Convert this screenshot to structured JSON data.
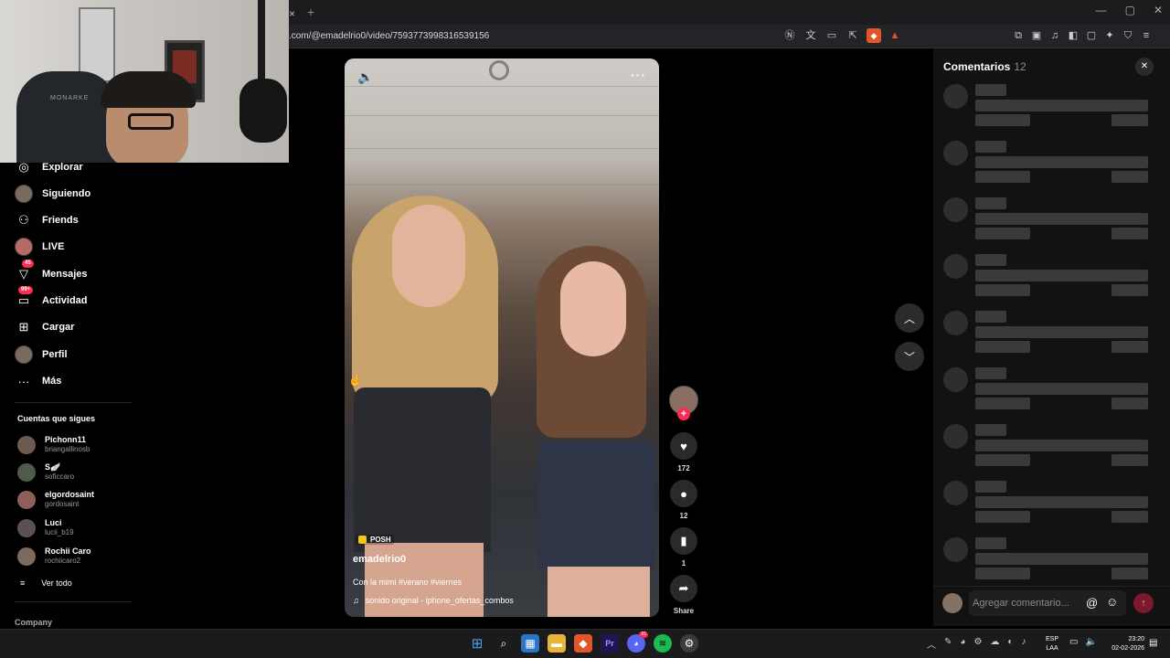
{
  "browser": {
    "url": ".com/@emadelrio0/video/7593773998316539156",
    "tab_close": "×",
    "tab_new": "+",
    "window_controls": [
      "—",
      "▢",
      "✕"
    ]
  },
  "webcam": {
    "chair_brand": "MONARKE"
  },
  "sidebar": {
    "nav": [
      {
        "label": "Explorar",
        "icon": "compass-icon",
        "glyph": "◉"
      },
      {
        "label": "Siguiendo",
        "icon": "following-avatar"
      },
      {
        "label": "Friends",
        "icon": "friends-icon",
        "glyph": "⚇"
      },
      {
        "label": "LIVE",
        "icon": "live-avatar"
      },
      {
        "label": "Mensajes",
        "icon": "messages-icon",
        "glyph": "▽",
        "badge": "45"
      },
      {
        "label": "Actividad",
        "icon": "activity-icon",
        "glyph": "▭",
        "badge": "99+"
      },
      {
        "label": "Cargar",
        "icon": "upload-icon",
        "glyph": "⊞"
      },
      {
        "label": "Perfil",
        "icon": "profile-avatar"
      },
      {
        "label": "Más",
        "icon": "more-icon",
        "glyph": "···"
      }
    ],
    "following_title": "Cuentas que sigues",
    "following": [
      {
        "name": "Pichonn11",
        "user": "briangallinosb"
      },
      {
        "name": "S🪽",
        "user": "soficcaro"
      },
      {
        "name": "elgordosaint",
        "user": "gordosaint"
      },
      {
        "name": "Luci",
        "user": "lucii_b19"
      },
      {
        "name": "Rochii Caro",
        "user": "rochiicaro2"
      }
    ],
    "see_all": "Ver todo",
    "company": "Company"
  },
  "video": {
    "sticker": "POSH",
    "author": "emadelrio0",
    "caption": "Con la mimi #verano #viernes",
    "sound": "sonido original - iphone_ofertas_combos"
  },
  "actions": {
    "likes": "172",
    "comments": "12",
    "saves": "1",
    "share_label": "Share"
  },
  "comments": {
    "title": "Comentarios",
    "count": "12",
    "placeholder": "Agregar comentario...",
    "skeleton_rows": 9
  },
  "taskbar": {
    "lang_top": "ESP",
    "lang_bottom": "LAA",
    "time": "23:20",
    "date": "02-02-2026",
    "discord_badge": "91"
  },
  "colors": {
    "accent": "#fe2c55",
    "panel": "#121212",
    "skeleton": "#3a3a3a"
  }
}
